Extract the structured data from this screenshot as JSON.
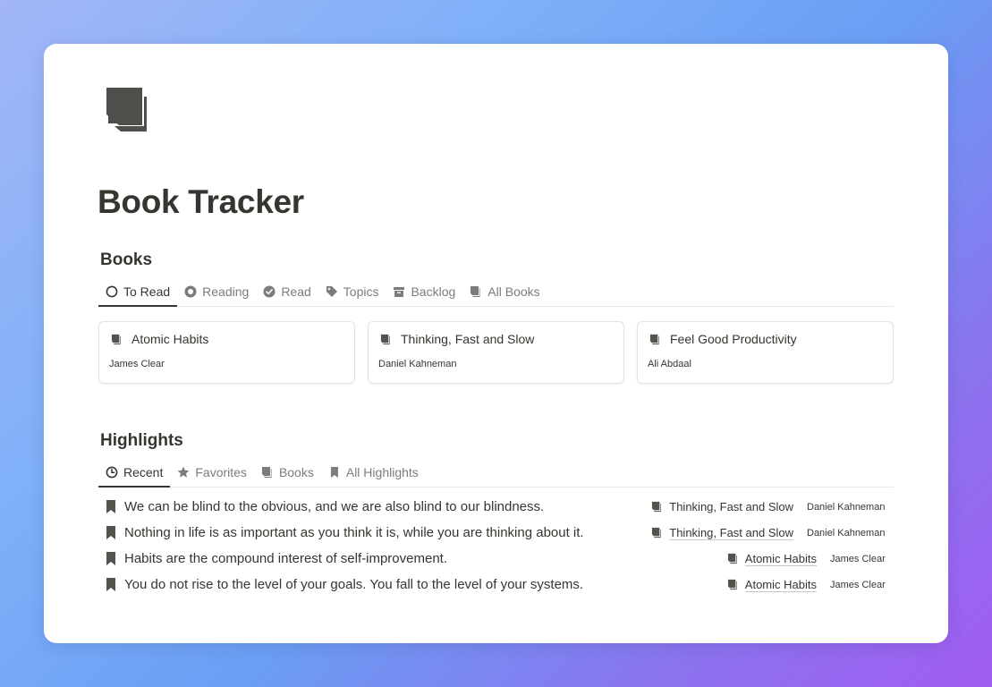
{
  "page": {
    "title": "Book Tracker",
    "icon": "books-icon"
  },
  "books_section": {
    "title": "Books",
    "tabs": [
      {
        "label": "To Read",
        "icon": "circle-outline-icon",
        "active": true
      },
      {
        "label": "Reading",
        "icon": "circle-dot-icon",
        "active": false
      },
      {
        "label": "Read",
        "icon": "check-circle-icon",
        "active": false
      },
      {
        "label": "Topics",
        "icon": "tag-icon",
        "active": false
      },
      {
        "label": "Backlog",
        "icon": "archive-icon",
        "active": false
      },
      {
        "label": "All Books",
        "icon": "book-icon",
        "active": false
      }
    ],
    "cards": [
      {
        "title": "Atomic Habits",
        "author": "James Clear"
      },
      {
        "title": "Thinking, Fast and Slow",
        "author": "Daniel Kahneman"
      },
      {
        "title": "Feel Good Productivity",
        "author": "Ali Abdaal"
      }
    ]
  },
  "highlights_section": {
    "title": "Highlights",
    "tabs": [
      {
        "label": "Recent",
        "icon": "clock-icon",
        "active": true
      },
      {
        "label": "Favorites",
        "icon": "star-icon",
        "active": false
      },
      {
        "label": "Books",
        "icon": "book-icon",
        "active": false
      },
      {
        "label": "All Highlights",
        "icon": "bookmark-icon",
        "active": false
      }
    ],
    "rows": [
      {
        "text": "We can be blind to the obvious, and we are also blind to our blindness.",
        "book": "Thinking, Fast and Slow",
        "author": "Daniel Kahneman"
      },
      {
        "text": "Nothing in life is as important as you think it is, while you are thinking about it.",
        "book": "Thinking, Fast and Slow",
        "author": "Daniel Kahneman"
      },
      {
        "text": "Habits are the compound interest of self-improvement.",
        "book": "Atomic Habits",
        "author": "James Clear"
      },
      {
        "text": "You do not rise to the level of your goals. You fall to the level of your systems.",
        "book": "Atomic Habits",
        "author": "James Clear"
      }
    ]
  },
  "colors": {
    "text": "#37352f",
    "muted": "#7d7c78",
    "icon": "#55534e",
    "border": "#e9e9e7"
  }
}
